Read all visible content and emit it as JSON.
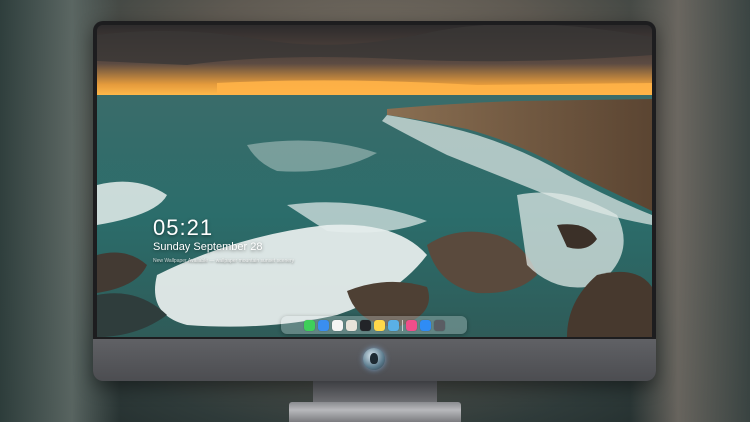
{
  "lock_screen": {
    "time": "05:21",
    "date": "Sunday September 28",
    "subline": "New Wallpaper Available — wallpaper mountain sunset scenery"
  },
  "dock": {
    "icons": [
      {
        "name": "messages-icon",
        "color": "#3ecf5a"
      },
      {
        "name": "weather-icon",
        "color": "#3a8ef0"
      },
      {
        "name": "clock-icon",
        "color": "#f4f4f4"
      },
      {
        "name": "maps-icon",
        "color": "#e7e3da"
      },
      {
        "name": "clapper-icon",
        "color": "#222428"
      },
      {
        "name": "notes-icon",
        "color": "#ffd84a"
      },
      {
        "name": "photos-icon",
        "color": "#5ab0e6"
      },
      {
        "name": "separator",
        "color": "#ffffff"
      },
      {
        "name": "music-icon",
        "color": "#f04e8a"
      },
      {
        "name": "app-store-icon",
        "color": "#2f8cf5"
      },
      {
        "name": "camera-icon",
        "color": "#5a5d63"
      }
    ]
  },
  "colors": {
    "monitor_bezel": "#1d1d1f",
    "monitor_chin": "#58595d",
    "sunset_accent": "#f2a33a"
  }
}
